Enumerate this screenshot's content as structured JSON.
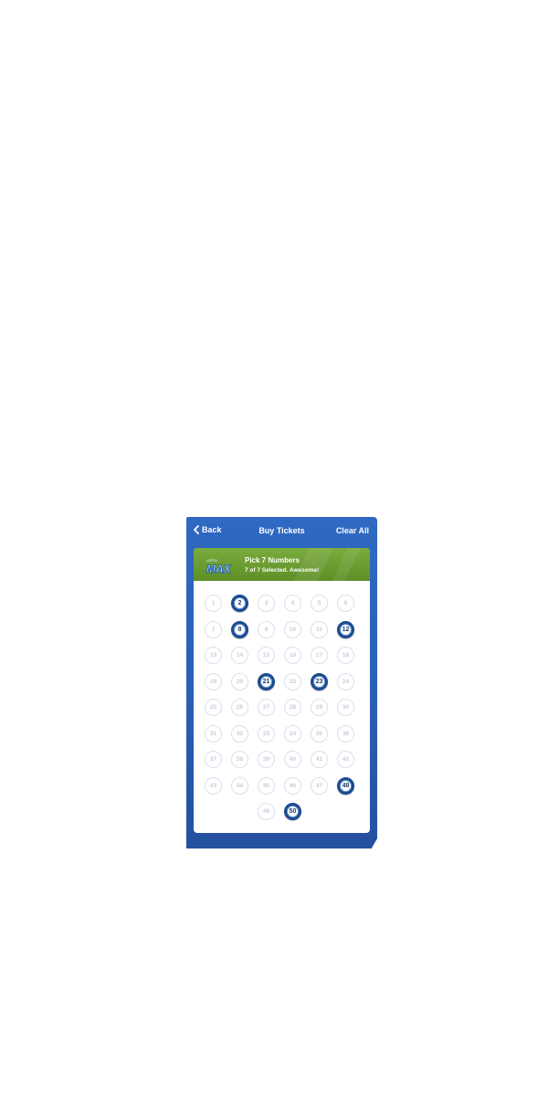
{
  "nav": {
    "back_label": "Back",
    "title": "Buy Tickets",
    "clear_label": "Clear All"
  },
  "banner": {
    "logo_text": "MAX",
    "logo_small_text": "LOTTO",
    "title": "Pick 7 Numbers",
    "subtitle": "7 of 7 Selected. Awesome!"
  },
  "numbers": {
    "total": 50,
    "columns": 6,
    "selected": [
      2,
      8,
      12,
      21,
      23,
      48,
      50
    ]
  },
  "colors": {
    "nav_blue": "#2f69c2",
    "banner_green": "#6e9f33",
    "selected_ring": "#1d4a8f",
    "unselected_text": "#c6ced9"
  }
}
